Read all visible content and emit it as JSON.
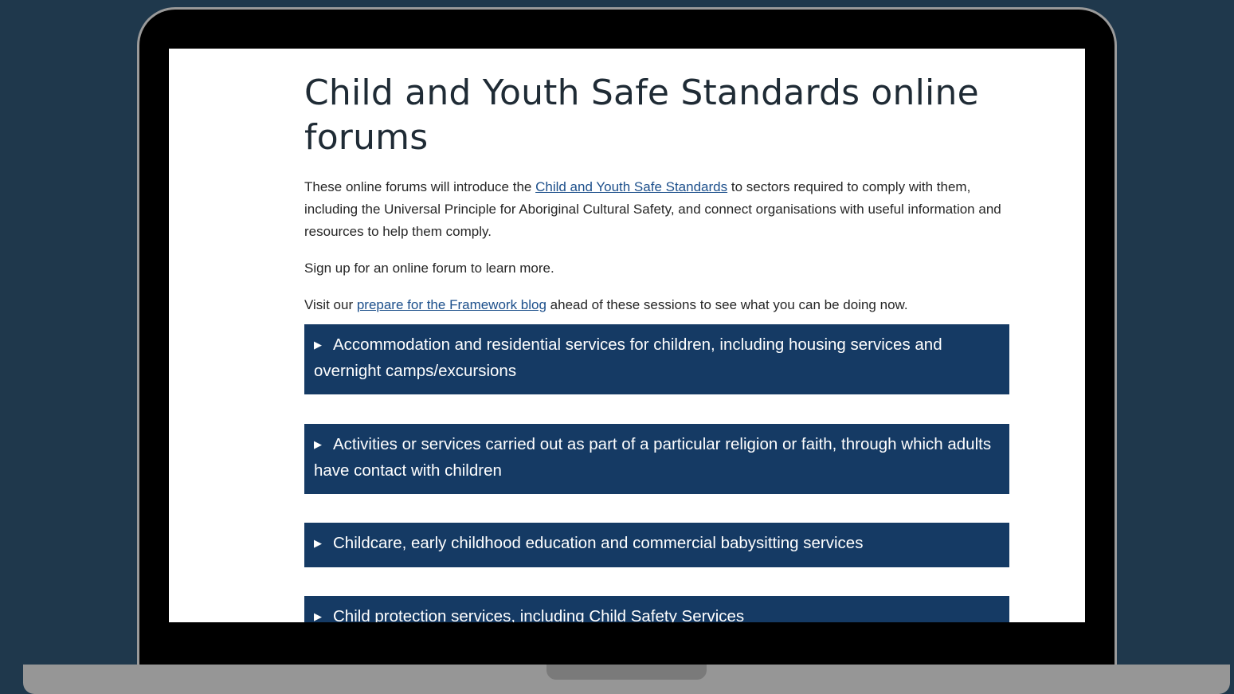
{
  "page": {
    "title": "Child and Youth Safe Standards online forums",
    "intro": {
      "before_link": "These online forums will introduce the ",
      "link_text": "Child and Youth Safe Standards",
      "after_link": " to sectors required to comply with them, including the Universal Principle for Aboriginal Cultural Safety, and connect organisations with useful information and resources to help them comply."
    },
    "signup_text": "Sign up for an online forum to learn more.",
    "visit": {
      "before_link": "Visit our ",
      "link_text": "prepare for the Framework blog",
      "after_link": " ahead of these sessions to see what you can be doing now."
    },
    "accordions": [
      {
        "label": "Accommodation and residential services for children, including housing services and overnight camps/excursions",
        "icon": "triangle-right-icon"
      },
      {
        "label": "Activities or services carried out as part of a particular religion or faith, through which adults have contact with children",
        "icon": "triangle-right-icon"
      },
      {
        "label": "Childcare, early childhood education and commercial babysitting services",
        "icon": "triangle-right-icon"
      },
      {
        "label": "Child protection services, including Child Safety Services",
        "icon": "triangle-right-icon"
      }
    ],
    "arrow_glyph": "▶"
  },
  "colors": {
    "background": "#1f384c",
    "accordion": "#153a64",
    "link": "#1c4f8b",
    "frame": "#000000"
  }
}
